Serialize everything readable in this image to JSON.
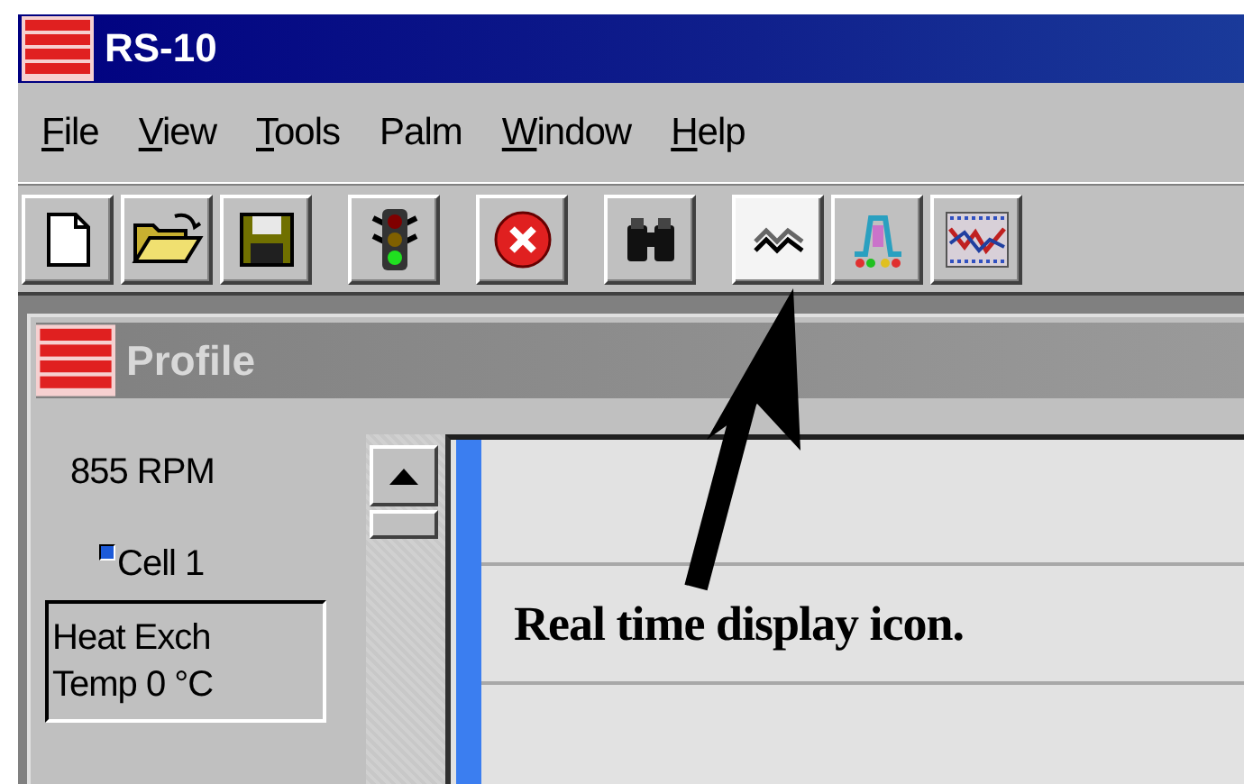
{
  "window": {
    "title": "RS-10"
  },
  "menu": [
    {
      "label": "File",
      "mnemonic": true
    },
    {
      "label": "View",
      "mnemonic": true
    },
    {
      "label": "Tools",
      "mnemonic": true
    },
    {
      "label": "Palm",
      "mnemonic": false
    },
    {
      "label": "Window",
      "mnemonic": true
    },
    {
      "label": "Help",
      "mnemonic": true
    }
  ],
  "toolbar": [
    [
      {
        "kind": "new",
        "pressed": false
      },
      {
        "kind": "open",
        "pressed": false
      },
      {
        "kind": "save",
        "pressed": false
      }
    ],
    [
      {
        "kind": "run",
        "pressed": false
      }
    ],
    [
      {
        "kind": "stop",
        "pressed": false
      }
    ],
    [
      {
        "kind": "find",
        "pressed": false
      }
    ],
    [
      {
        "kind": "realtime",
        "pressed": true
      },
      {
        "kind": "profile",
        "pressed": false
      },
      {
        "kind": "graph",
        "pressed": false
      }
    ]
  ],
  "profile_window": {
    "title": "Profile",
    "active": false,
    "rpm": "855 RPM",
    "cell": {
      "label": "Cell 1",
      "checked": true
    },
    "readout": [
      "Heat Exch",
      "Temp 0 °C"
    ]
  },
  "annotation": "Real time display icon."
}
